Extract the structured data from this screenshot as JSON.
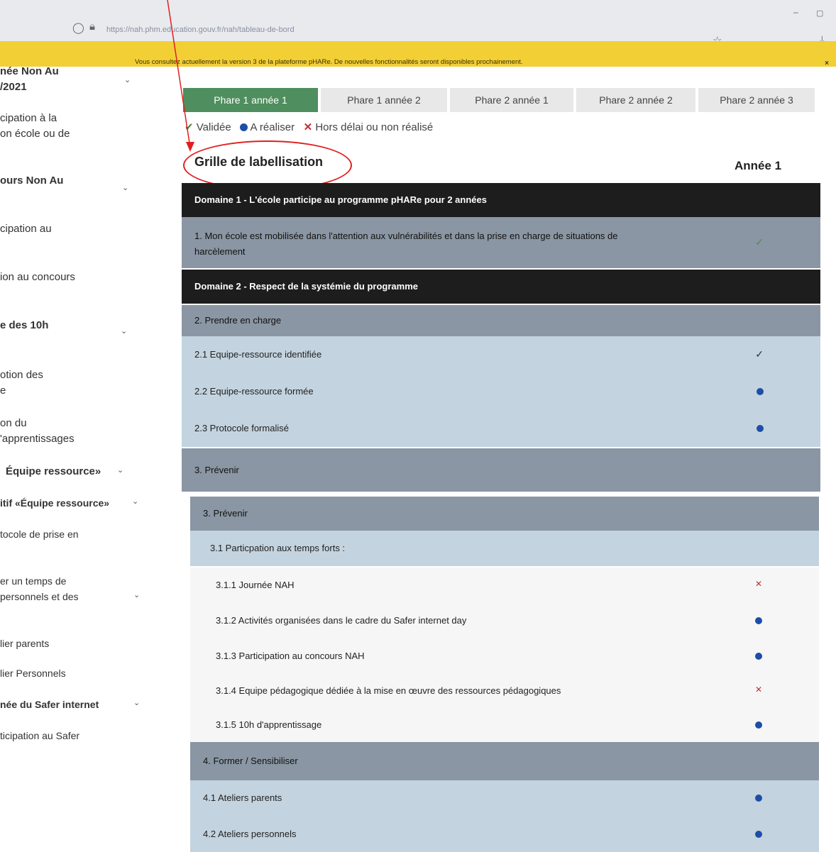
{
  "browser": {
    "url": "https://nah.phm.education.gouv.fr/nah/tableau-de-bord"
  },
  "banner": {
    "text": "Vous consultez actuellement la version 3 de la plateforme pHARe. De nouvelles fonctionnalités seront disponibles prochainement.",
    "close": "×"
  },
  "sidebar": {
    "items": [
      {
        "label": "née Non Au",
        "bold": true
      },
      {
        "label": "/2021",
        "bold": true
      },
      {
        "label": "cipation à la"
      },
      {
        "label": "on école ou de"
      },
      {
        "label": "ours Non Au",
        "bold": true
      },
      {
        "label": "cipation au"
      },
      {
        "label": "ion au concours"
      },
      {
        "label": "e des 10h",
        "bold": true
      },
      {
        "label": "otion des"
      },
      {
        "label": "e"
      },
      {
        "label": "on du"
      },
      {
        "label": "'apprentissages"
      },
      {
        "label": "Équipe ressource»",
        "bold": true
      },
      {
        "label": "itif «Équipe ressource»",
        "bold": true
      },
      {
        "label": "tocole de prise en"
      },
      {
        "label": "er un temps de"
      },
      {
        "label": "personnels et des"
      },
      {
        "label": "lier parents"
      },
      {
        "label": "lier Personnels"
      },
      {
        "label": "née du Safer internet",
        "bold": true
      },
      {
        "label": "ticipation au Safer"
      }
    ]
  },
  "stepper": [
    {
      "label": "Phare 1 année 1",
      "active": true
    },
    {
      "label": "Phare 1 année 2"
    },
    {
      "label": "Phare 2 année 1"
    },
    {
      "label": "Phare 2 année 2"
    },
    {
      "label": "Phare 2 année 3"
    }
  ],
  "legend": {
    "validated": "Validée",
    "todo": "A réaliser",
    "late": "Hors délai ou non réalisé"
  },
  "grid": {
    "title": "Grille de labellisation",
    "year": "Année 1",
    "rows": [
      {
        "kind": "dom",
        "label": "Domaine 1 - L'école participe au programme pHARe pour 2 années"
      },
      {
        "kind": "sec",
        "label": "1. Mon école est mobilisée dans l'attention aux vulnérabilités et dans la prise en charge de situations de harcèlement",
        "status": "validated"
      },
      {
        "kind": "dom",
        "label": "Domaine 2 - Respect de la systémie du programme"
      },
      {
        "kind": "sec",
        "label": "2. Prendre en charge"
      },
      {
        "kind": "item",
        "label": "2.1 Equipe-ressource identifiée",
        "status": "validated"
      },
      {
        "kind": "item",
        "label": "2.2 Equipe-ressource formée",
        "status": "todo"
      },
      {
        "kind": "item",
        "label": "2.3 Protocole formalisé",
        "status": "todo"
      },
      {
        "kind": "sec",
        "label": "3. Prévenir"
      },
      {
        "kind": "sec",
        "label": "3. Prévenir"
      },
      {
        "kind": "item",
        "label": "3.1 Particpation aux temps forts :"
      },
      {
        "kind": "lite",
        "label": "3.1.1 Journée NAH",
        "status": "late"
      },
      {
        "kind": "lite",
        "label": "3.1.2 Activités organisées dans le cadre du Safer internet day",
        "status": "todo"
      },
      {
        "kind": "lite",
        "label": "3.1.3 Participation au concours NAH",
        "status": "todo"
      },
      {
        "kind": "lite",
        "label": "3.1.4 Equipe pédagogique dédiée à la mise en œuvre des ressources pédagogiques",
        "status": "late"
      },
      {
        "kind": "lite",
        "label": "3.1.5 10h d'apprentissage",
        "status": "todo"
      },
      {
        "kind": "sec",
        "label": "4. Former / Sensibiliser"
      },
      {
        "kind": "item",
        "label": "4.1 Ateliers parents",
        "status": "todo"
      },
      {
        "kind": "item",
        "label": "4.2 Ateliers personnels",
        "status": "todo"
      }
    ]
  },
  "colors": {
    "banner": "#f2cf35",
    "active_step": "#4f8e5e",
    "domain_row": "#1d1d1d",
    "section_row": "#8a96a3",
    "item_row": "#c3d3df",
    "dot_blue": "#1e4da8",
    "x_red": "#c23030",
    "annotation_red": "#e02020"
  },
  "icons": {
    "validated": "check-icon",
    "todo": "blue-dot-icon",
    "late": "red-x-icon"
  }
}
